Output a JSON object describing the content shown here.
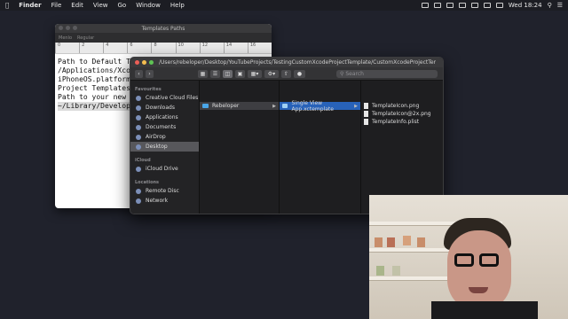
{
  "menubar": {
    "app_name": "Finder",
    "menus": [
      "File",
      "Edit",
      "View",
      "Go",
      "Window",
      "Help"
    ],
    "clock": "Wed 18:24"
  },
  "textedit": {
    "title": "Templates Paths",
    "toolbar": {
      "font_family": "Menlo",
      "font_style": "Regular"
    },
    "ruler_marks": [
      "0",
      "2",
      "4",
      "6",
      "8",
      "10",
      "12",
      "14",
      "16"
    ],
    "lines": [
      "Path to Default Te",
      "",
      "/Applications/Xcode",
      "iPhoneOS.platform/D",
      "Project Templates",
      "",
      "Path to your new te",
      "",
      "~/Library/Developer"
    ]
  },
  "finder": {
    "path": "/Users/rebeloper/Desktop/YouTubeProjects/TestingCustomXcodeProjectTemplate/CustomXcodeProjectTemplateRe...",
    "search_placeholder": "Search",
    "sidebar": {
      "favourites_header": "Favourites",
      "favourites": [
        {
          "label": "Creative Cloud Files",
          "icon": "creative-cloud-icon"
        },
        {
          "label": "Downloads",
          "icon": "downloads-icon"
        },
        {
          "label": "Applications",
          "icon": "applications-icon"
        },
        {
          "label": "Documents",
          "icon": "documents-icon"
        },
        {
          "label": "AirDrop",
          "icon": "airdrop-icon"
        },
        {
          "label": "Desktop",
          "icon": "desktop-icon",
          "selected": true
        }
      ],
      "icloud_header": "iCloud",
      "icloud": [
        {
          "label": "iCloud Drive",
          "icon": "icloud-drive-icon"
        }
      ],
      "locations_header": "Locations",
      "locations": [
        {
          "label": "Remote Disc",
          "icon": "remote-disc-icon"
        },
        {
          "label": "Network",
          "icon": "network-icon"
        }
      ]
    },
    "columns": [
      {
        "items": [
          {
            "label": "Rebeloper",
            "type": "folder",
            "selected": true
          }
        ]
      },
      {
        "items": [
          {
            "label": "Single View App.xctemplate",
            "type": "folder",
            "selected": true,
            "active": true
          }
        ]
      },
      {
        "items": [
          {
            "label": "TemplateIcon.png",
            "type": "file"
          },
          {
            "label": "TemplateIcon@2x.png",
            "type": "file"
          },
          {
            "label": "TemplateInfo.plist",
            "type": "file"
          }
        ]
      }
    ]
  },
  "colors": {
    "desktop": "#20222c",
    "finder_bg": "#1e1e20",
    "selection_blue": "#2862b9",
    "folder_blue": "#4aa6e8"
  }
}
